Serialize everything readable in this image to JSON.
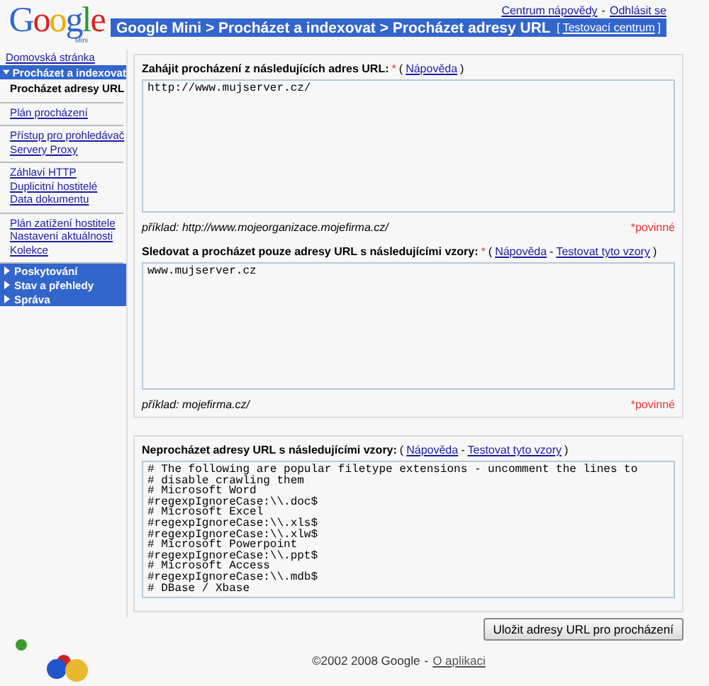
{
  "header": {
    "logo": {
      "word": "Google",
      "sub": "Mini"
    },
    "top_links": [
      {
        "label": "Centrum nápovědy"
      },
      {
        "label": "Odhlásit se"
      }
    ],
    "top_separator": "-",
    "breadcrumb": "Google Mini > Procházet a indexovat > Procházet adresy URL",
    "test_center": {
      "open": "[",
      "label": "Testovací centrum",
      "close": "]"
    }
  },
  "sidebar": {
    "home": "Domovská stránka",
    "sections": [
      {
        "label": "Procházet a indexovat",
        "expanded": true,
        "groups": [
          [
            {
              "label": "Procházet adresy URL",
              "selected": true
            }
          ],
          [
            {
              "label": "Plán procházení",
              "selected": false
            }
          ],
          [
            {
              "label": "Přístup pro prohledávač",
              "selected": false
            },
            {
              "label": "Servery Proxy",
              "selected": false
            }
          ],
          [
            {
              "label": "Záhlaví HTTP",
              "selected": false
            },
            {
              "label": "Duplicitní hostitelé",
              "selected": false
            },
            {
              "label": "Data dokumentu",
              "selected": false
            }
          ],
          [
            {
              "label": "Plán zatížení hostitele",
              "selected": false
            },
            {
              "label": "Nastavení aktuálnosti",
              "selected": false
            },
            {
              "label": "Kolekce",
              "selected": false
            }
          ]
        ]
      },
      {
        "label": "Poskytování",
        "expanded": false
      },
      {
        "label": "Stav a přehledy",
        "expanded": false
      },
      {
        "label": "Správa",
        "expanded": false
      }
    ]
  },
  "panels": [
    {
      "fields": [
        {
          "heading": "Zahájit procházení z následujících adres URL:",
          "required_mark": "*",
          "brackets": [
            "(",
            ")"
          ],
          "links": [
            {
              "label": "Nápověda"
            }
          ],
          "lines": [
            "http://www.mujserver.cz/"
          ],
          "example": "příklad: http://www.mojeorganizace.mojefirma.cz/",
          "required_note": "*povinné"
        },
        {
          "heading": "Sledovat a procházet pouze adresy URL s následujícími vzory:",
          "required_mark": "*",
          "brackets": [
            "(",
            ")"
          ],
          "link_separator": "-",
          "links": [
            {
              "label": "Nápověda"
            },
            {
              "label": "Testovat tyto vzory"
            }
          ],
          "lines": [
            "www.mujserver.cz"
          ],
          "example": "příklad: mojefirma.cz/",
          "required_note": "*povinné"
        }
      ]
    },
    {
      "fields": [
        {
          "heading": "Neprocházet adresy URL s následujícími vzory:",
          "brackets": [
            "(",
            ")"
          ],
          "link_separator": "-",
          "links": [
            {
              "label": "Nápověda"
            },
            {
              "label": "Testovat tyto vzory"
            }
          ],
          "lines": [
            "# The following are popular filetype extensions - uncomment the lines to",
            "# disable crawling them",
            "# Microsoft Word",
            "#regexpIgnoreCase:\\\\.doc$",
            "# Microsoft Excel",
            "#regexpIgnoreCase:\\\\.xls$",
            "#regexpIgnoreCase:\\\\.xlw$",
            "# Microsoft Powerpoint",
            "#regexpIgnoreCase:\\\\.ppt$",
            "# Microsoft Access",
            "#regexpIgnoreCase:\\\\.mdb$",
            "# DBase / Xbase"
          ]
        }
      ]
    }
  ],
  "save_button": "Uložit adresy URL pro procházení",
  "footer": {
    "copyright": "©2002 2008 Google",
    "separator": "-",
    "about": "O aplikaci"
  }
}
